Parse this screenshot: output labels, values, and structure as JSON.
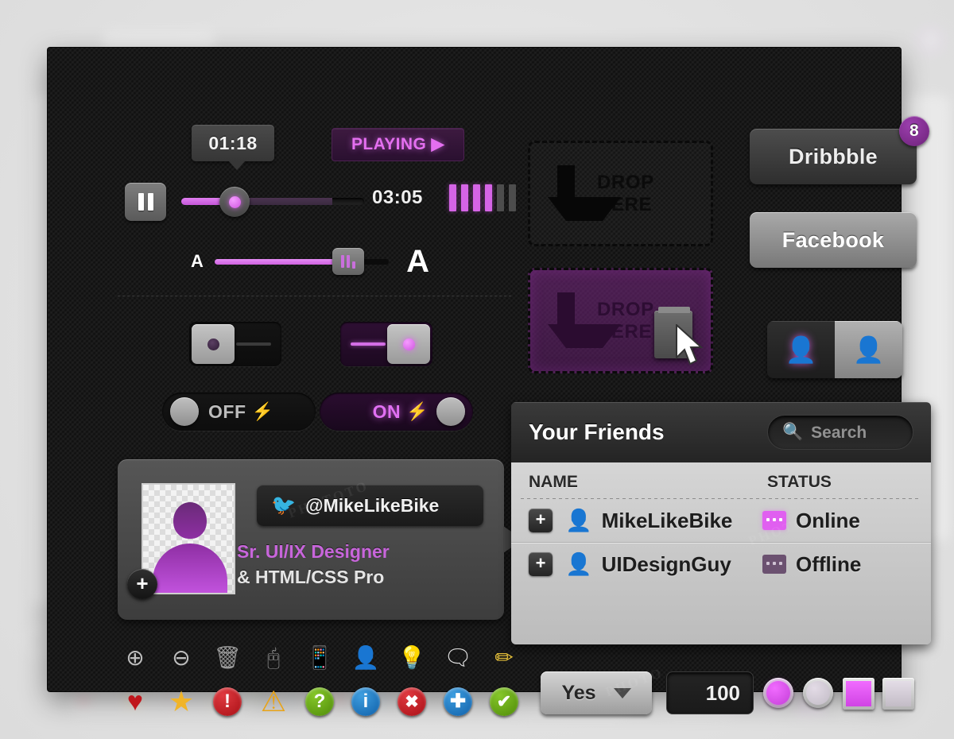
{
  "player": {
    "tooltip_time": "01:18",
    "status_label": "PLAYING",
    "status_glyph": "▶",
    "total_time": "03:05",
    "pause_icon": "pause-icon",
    "eq_bars": [
      1,
      1,
      1,
      1,
      0,
      0
    ],
    "fontsize_small": "A",
    "fontsize_large": "A"
  },
  "switches": {
    "off_slider": "off",
    "on_slider": "on",
    "off_pill_label": "OFF",
    "on_pill_label": "ON",
    "bolt_glyph": "⚡"
  },
  "dropzones": [
    {
      "line1": "DROP",
      "line2": "HERE",
      "state": "idle"
    },
    {
      "line1": "DROP",
      "line2": "HERE",
      "state": "active"
    }
  ],
  "social": {
    "dribbble_label": "Dribbble",
    "dribbble_badge": "8",
    "facebook_label": "Facebook",
    "segment": [
      {
        "icon": "user-icon",
        "state": "active"
      },
      {
        "icon": "user-icon",
        "state": "inactive"
      }
    ]
  },
  "profile": {
    "handle": "@MikeLikeBike",
    "twitter_icon": "twitter-bird-icon",
    "role_line1": "Sr. UI/IX Designer",
    "role_line2": "& HTML/CSS Pro",
    "add_badge": "+",
    "avatar_icon": "avatar-placeholder-icon"
  },
  "friends": {
    "title": "Your Friends",
    "search_placeholder": "Search",
    "search_value": "",
    "columns": [
      "NAME",
      "STATUS"
    ],
    "rows": [
      {
        "expand": "+",
        "name": "MikeLikeBike",
        "status": "Online",
        "online": true
      },
      {
        "expand": "+",
        "name": "UIDesignGuy",
        "status": "Offline",
        "online": false
      }
    ]
  },
  "icon_row_1": [
    {
      "name": "zoom-in-icon",
      "glyph": "⊕"
    },
    {
      "name": "zoom-out-icon",
      "glyph": "⊖"
    },
    {
      "name": "trash-icon",
      "glyph": "🗑"
    },
    {
      "name": "mouse-icon",
      "glyph": "🖰"
    },
    {
      "name": "mobile-share-icon",
      "glyph": "📱"
    },
    {
      "name": "add-user-icon",
      "glyph": "👤"
    },
    {
      "name": "lightbulb-icon",
      "glyph": "💡"
    },
    {
      "name": "comment-icon",
      "glyph": "🗨"
    },
    {
      "name": "pencil-icon",
      "glyph": "✏"
    }
  ],
  "icon_row_2": [
    {
      "name": "heart-icon",
      "glyph": "♥",
      "color": "#c0161c"
    },
    {
      "name": "star-icon",
      "glyph": "★",
      "color": "#f0b429"
    },
    {
      "name": "error-icon",
      "glyph": "!",
      "color": "#c81a1f"
    },
    {
      "name": "warning-icon",
      "glyph": "!",
      "color": "#e8a317"
    },
    {
      "name": "help-icon",
      "glyph": "?",
      "color": "#62a80f"
    },
    {
      "name": "info-icon",
      "glyph": "i",
      "color": "#1572c4"
    },
    {
      "name": "close-icon",
      "glyph": "✖",
      "color": "#c81a1f"
    },
    {
      "name": "add-icon",
      "glyph": "✚",
      "color": "#1572c4"
    },
    {
      "name": "check-icon",
      "glyph": "✔",
      "color": "#62a80f"
    }
  ],
  "form": {
    "select_value": "Yes",
    "select_caret": "chevron-down-icon",
    "number_value": "100",
    "radios": [
      {
        "state": "selected"
      },
      {
        "state": "unselected"
      }
    ],
    "checkboxes": [
      {
        "state": "selected"
      },
      {
        "state": "unselected"
      }
    ]
  },
  "colors": {
    "accent": "#d564e6",
    "panel_bg": "#191919",
    "page_bg": "#e6e6e6"
  }
}
